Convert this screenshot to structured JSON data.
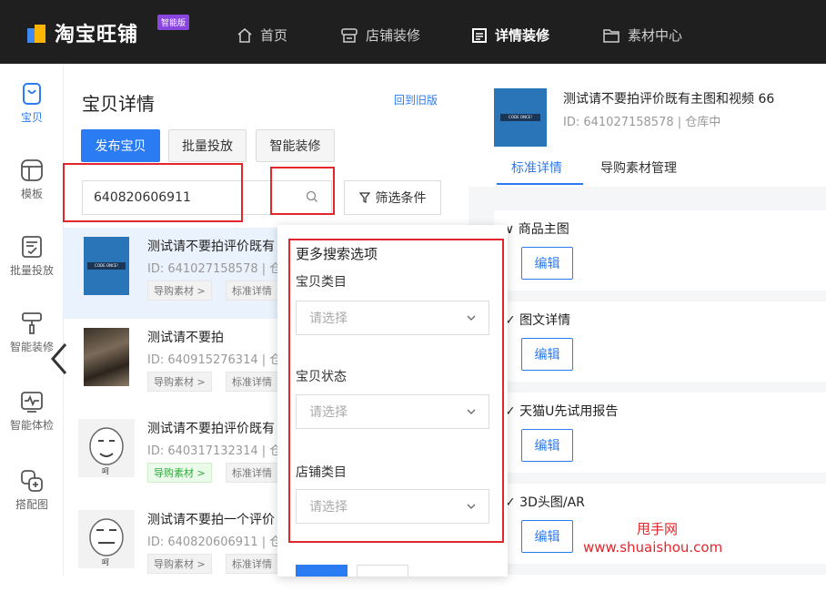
{
  "topbar": {
    "logo_text": "淘宝旺铺",
    "logo_badge": "智能版",
    "nav": [
      {
        "label": "首页",
        "icon": "home-icon"
      },
      {
        "label": "店铺装修",
        "icon": "shop-icon"
      },
      {
        "label": "详情装修",
        "icon": "document-icon",
        "active": true
      },
      {
        "label": "素材中心",
        "icon": "folder-icon"
      }
    ]
  },
  "sidebar": {
    "items": [
      {
        "label": "宝贝",
        "icon": "bag-icon",
        "active": true
      },
      {
        "label": "模板",
        "icon": "template-icon"
      },
      {
        "label": "批量投放",
        "icon": "batch-icon"
      },
      {
        "label": "智能装修",
        "icon": "paint-roller-icon"
      },
      {
        "label": "智能体检",
        "icon": "health-check-icon"
      },
      {
        "label": "搭配图",
        "icon": "combine-icon"
      }
    ]
  },
  "panel": {
    "title": "宝贝详情",
    "back_link": "回到旧版",
    "buttons": {
      "publish": "发布宝贝",
      "batch": "批量投放",
      "smart": "智能装修"
    },
    "search_value": "640820606911",
    "filter_label": "筛选条件"
  },
  "items": [
    {
      "title": "测试请不要拍评价既有",
      "id": "ID: 641027158578 | 仓",
      "tags": [
        "导购素材 >",
        "标准详情"
      ]
    },
    {
      "title": "测试请不要拍",
      "id": "ID: 640915276314 | 仓",
      "tags": [
        "导购素材 >",
        "标准详情"
      ]
    },
    {
      "title": "测试请不要拍评价既有",
      "id": "ID: 640317132314 | 仓",
      "tags": [
        "导购素材 >",
        "标准详情"
      ]
    },
    {
      "title": "测试请不要拍一个评价",
      "id": "ID: 640820606911 | 仓",
      "tags": [
        "导购素材 >",
        "标准详情"
      ]
    }
  ],
  "dropdown": {
    "title": "更多搜索选项",
    "fields": [
      {
        "label": "宝贝类目",
        "placeholder": "请选择"
      },
      {
        "label": "宝贝状态",
        "placeholder": "请选择"
      },
      {
        "label": "店铺类目",
        "placeholder": "请选择"
      }
    ]
  },
  "right": {
    "product_title": "测试请不要拍评价既有主图和视频 66",
    "product_id": "ID: 641027158578 | 仓库中",
    "tabs": [
      "标准详情",
      "导购素材管理"
    ],
    "sections": [
      {
        "title": "∨ 商品主图",
        "button": "编辑"
      },
      {
        "title": "✓ 图文详情",
        "button": "编辑"
      },
      {
        "title": "✓ 天猫U先试用报告",
        "button": "编辑"
      },
      {
        "title": "✓ 3D头图/AR",
        "button": "编辑"
      }
    ]
  },
  "watermark": {
    "line1": "甩手网",
    "line2": "www.shuaishou.com"
  },
  "thumb_text": "CODE ONCE!",
  "face_caption": "呵",
  "colors": {
    "accent": "#2b7bf2",
    "topbar": "#1f1f1f",
    "highlight": "#e3262b"
  }
}
